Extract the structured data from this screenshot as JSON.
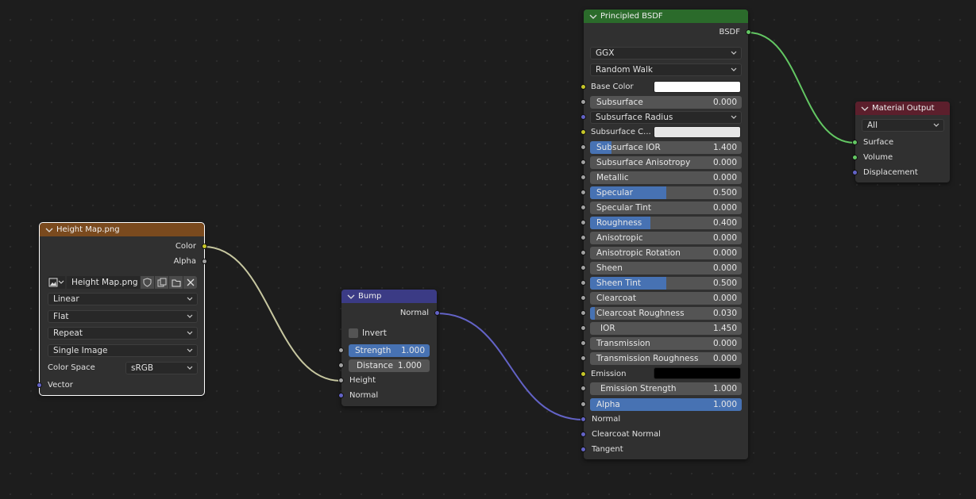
{
  "colors": {
    "image_texture_header": "#7a4a1e",
    "bump_header": "#3b3b85",
    "principled_header": "#2b6b2b",
    "output_header": "#5c1f2c",
    "wire_color": "#c7c7a0",
    "wire_vector": "#6363c7",
    "wire_shader": "#63c763"
  },
  "image_node": {
    "title": "Height Map.png",
    "outputs": [
      "Color",
      "Alpha"
    ],
    "image_name": "Height Map.png",
    "interpolation": "Linear",
    "projection": "Flat",
    "extension": "Repeat",
    "source": "Single Image",
    "color_space_label": "Color Space",
    "color_space": "sRGB",
    "input_vector": "Vector"
  },
  "bump_node": {
    "title": "Bump",
    "output": "Normal",
    "invert_label": "Invert",
    "strength_label": "Strength",
    "strength_value": "1.000",
    "distance_label": "Distance",
    "distance_value": "1.000",
    "input_height": "Height",
    "input_normal": "Normal"
  },
  "principled_node": {
    "title": "Principled BSDF",
    "output": "BSDF",
    "distribution": "GGX",
    "subsurface_method": "Random Walk",
    "base_color_label": "Base Color",
    "base_color_hex": "#ffffff",
    "subsurface_label": "Subsurface",
    "subsurface_value": "0.000",
    "subsurface_radius": "Subsurface Radius",
    "subsurface_color_label": "Subsurface C...",
    "subsurface_color_hex": "#e6e6e6",
    "sliders": [
      {
        "label": "Subsurface IOR",
        "value": "1.400",
        "fill": 0.14
      },
      {
        "label": "Subsurface Anisotropy",
        "value": "0.000",
        "fill": 0
      },
      {
        "label": "Metallic",
        "value": "0.000",
        "fill": 0
      },
      {
        "label": "Specular",
        "value": "0.500",
        "fill": 0.5
      },
      {
        "label": "Specular Tint",
        "value": "0.000",
        "fill": 0
      },
      {
        "label": "Roughness",
        "value": "0.400",
        "fill": 0.4
      },
      {
        "label": "Anisotropic",
        "value": "0.000",
        "fill": 0
      },
      {
        "label": "Anisotropic Rotation",
        "value": "0.000",
        "fill": 0
      },
      {
        "label": "Sheen",
        "value": "0.000",
        "fill": 0
      },
      {
        "label": "Sheen Tint",
        "value": "0.500",
        "fill": 0.5
      },
      {
        "label": "Clearcoat",
        "value": "0.000",
        "fill": 0
      },
      {
        "label": "Clearcoat Roughness",
        "value": "0.030",
        "fill": 0.03
      }
    ],
    "ior_label": "IOR",
    "ior_value": "1.450",
    "transmission_label": "Transmission",
    "transmission_value": "0.000",
    "transmission_roughness_label": "Transmission Roughness",
    "transmission_roughness_value": "0.000",
    "emission_label": "Emission",
    "emission_hex": "#000000",
    "emission_strength_label": "Emission Strength",
    "emission_strength_value": "1.000",
    "alpha_label": "Alpha",
    "alpha_value": "1.000",
    "alpha_fill": 1.0,
    "input_normal": "Normal",
    "input_clearcoat_normal": "Clearcoat Normal",
    "input_tangent": "Tangent"
  },
  "output_node": {
    "title": "Material Output",
    "target": "All",
    "inputs": [
      "Surface",
      "Volume",
      "Displacement"
    ]
  }
}
